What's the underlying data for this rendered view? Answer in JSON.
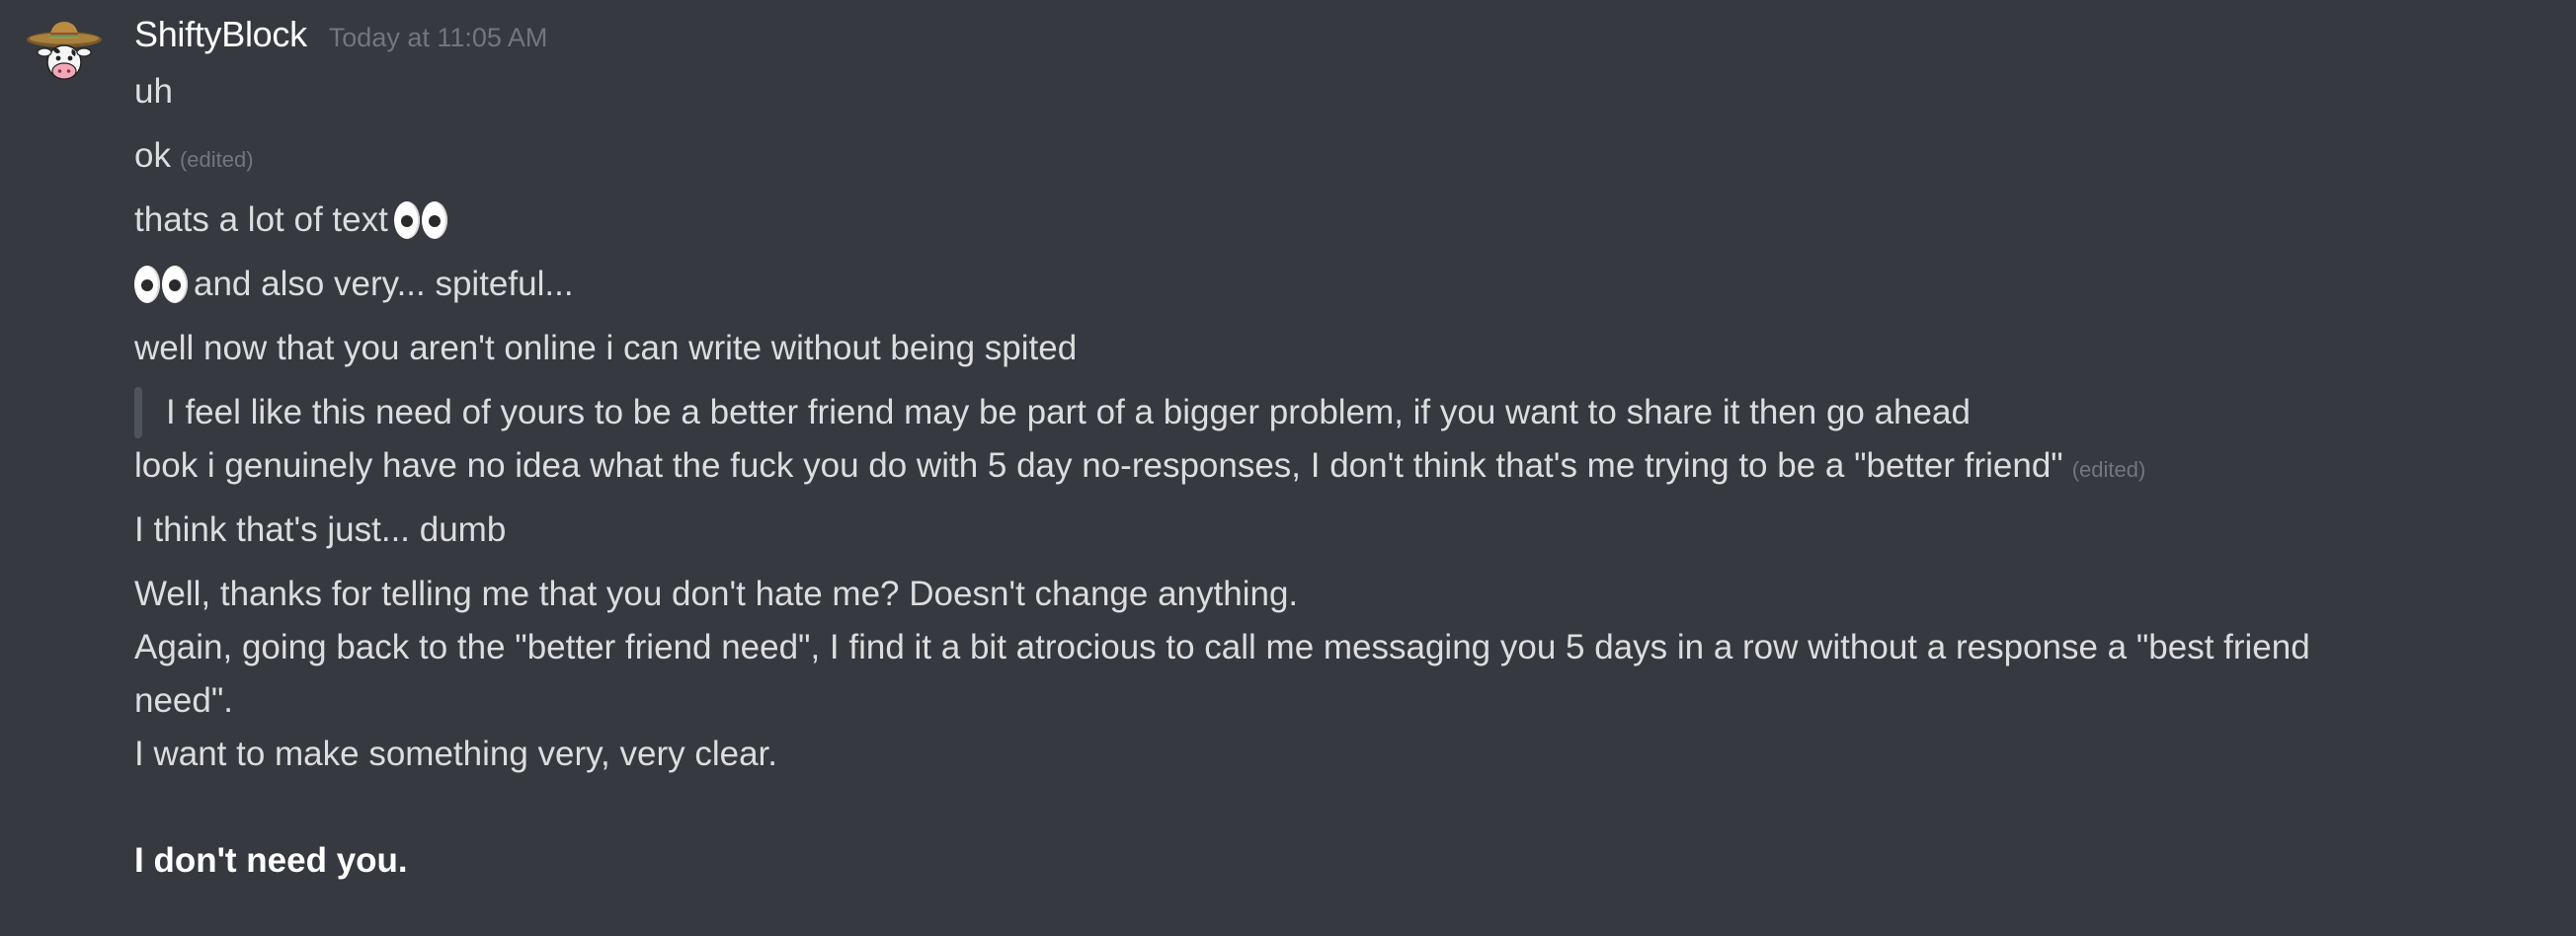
{
  "author": {
    "username": "ShiftyBlock",
    "timestamp": "Today at 11:05 AM"
  },
  "messages": {
    "m1": "uh",
    "m2": "ok",
    "m2_edited": "(edited)",
    "m3": "thats a lot of text",
    "m4": "and also very... spiteful...",
    "m5": "well now that you aren't online i can write without being spited",
    "m6_quote": "I feel like this need of yours to be a better friend may be part of a bigger problem, if you want to share it then go ahead",
    "m6_reply": "look i genuinely have no idea what the fuck you do with 5 day no-responses, I don't think that's me trying to be a \"better friend\"",
    "m6_edited": "(edited)",
    "m7": "I think that's just... dumb",
    "m8_line1": "Well, thanks for telling me that you don't hate me? Doesn't change anything.",
    "m8_line2": "Again, going back to the \"better friend need\", I find it a bit atrocious to call me messaging you 5 days in a row without a response a \"best friend",
    "m8_line3": "need\".",
    "m8_line4": "I want to make something very, very clear.",
    "m8_bold": "I don't need you."
  },
  "icons": {
    "avatar": "cow-with-sombrero-avatar",
    "emoji": "eyes-emoji"
  },
  "colors": {
    "background": "#36393f",
    "text": "#dcddde",
    "username": "#ffffff",
    "muted": "#72767d",
    "quote_bar": "#4f545c"
  }
}
